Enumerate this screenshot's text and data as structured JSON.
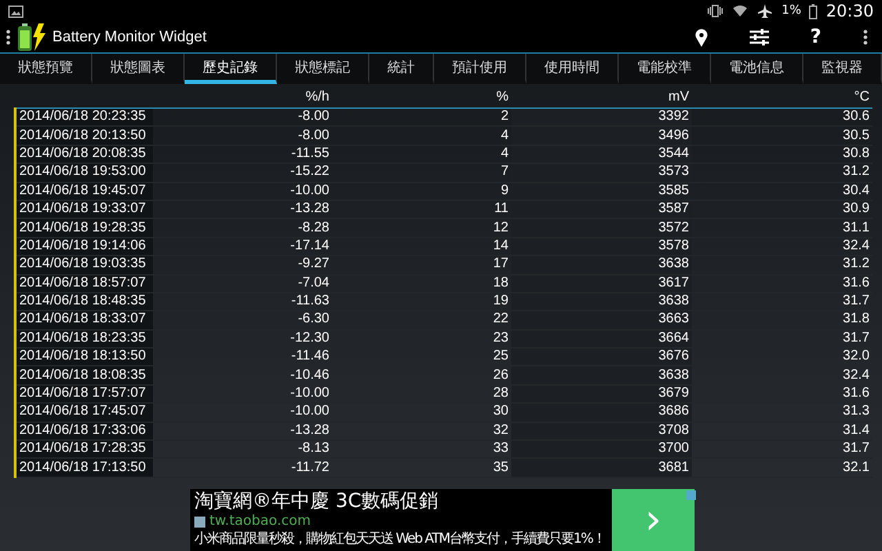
{
  "status_bar": {
    "battery": "1%",
    "time": "20:30"
  },
  "app_bar": {
    "title": "Battery Monitor Widget",
    "help": "?"
  },
  "tabs": [
    {
      "label": "狀態預覽",
      "selected": false
    },
    {
      "label": "狀態圖表",
      "selected": false
    },
    {
      "label": "歷史記錄",
      "selected": true
    },
    {
      "label": "狀態標記",
      "selected": false
    },
    {
      "label": "統計",
      "selected": false
    },
    {
      "label": "預計使用",
      "selected": false
    },
    {
      "label": "使用時間",
      "selected": false
    },
    {
      "label": "電能校準",
      "selected": false
    },
    {
      "label": "電池信息",
      "selected": false
    },
    {
      "label": "監視器",
      "selected": false
    }
  ],
  "table": {
    "columns": [
      "",
      "%/h",
      "%",
      "mV",
      "°C"
    ],
    "rows": [
      [
        "2014/06/18 20:23:35",
        "-8.00",
        "2",
        "3392",
        "30.6"
      ],
      [
        "2014/06/18 20:13:50",
        "-8.00",
        "4",
        "3496",
        "30.5"
      ],
      [
        "2014/06/18 20:08:35",
        "-11.55",
        "4",
        "3544",
        "30.8"
      ],
      [
        "2014/06/18 19:53:00",
        "-15.22",
        "7",
        "3573",
        "31.2"
      ],
      [
        "2014/06/18 19:45:07",
        "-10.00",
        "9",
        "3585",
        "30.4"
      ],
      [
        "2014/06/18 19:33:07",
        "-13.28",
        "11",
        "3587",
        "30.9"
      ],
      [
        "2014/06/18 19:28:35",
        "-8.28",
        "12",
        "3572",
        "31.1"
      ],
      [
        "2014/06/18 19:14:06",
        "-17.14",
        "14",
        "3578",
        "32.4"
      ],
      [
        "2014/06/18 19:03:35",
        "-9.27",
        "17",
        "3638",
        "31.2"
      ],
      [
        "2014/06/18 18:57:07",
        "-7.04",
        "18",
        "3617",
        "31.6"
      ],
      [
        "2014/06/18 18:48:35",
        "-11.63",
        "19",
        "3638",
        "31.7"
      ],
      [
        "2014/06/18 18:33:07",
        "-6.30",
        "22",
        "3663",
        "31.8"
      ],
      [
        "2014/06/18 18:23:35",
        "-12.30",
        "23",
        "3664",
        "31.7"
      ],
      [
        "2014/06/18 18:13:50",
        "-11.46",
        "25",
        "3676",
        "32.0"
      ],
      [
        "2014/06/18 18:08:35",
        "-10.46",
        "26",
        "3638",
        "32.4"
      ],
      [
        "2014/06/18 17:57:07",
        "-10.00",
        "28",
        "3679",
        "31.6"
      ],
      [
        "2014/06/18 17:45:07",
        "-10.00",
        "30",
        "3686",
        "31.3"
      ],
      [
        "2014/06/18 17:33:06",
        "-13.28",
        "32",
        "3708",
        "31.4"
      ],
      [
        "2014/06/18 17:28:35",
        "-8.13",
        "33",
        "3700",
        "31.7"
      ],
      [
        "2014/06/18 17:13:50",
        "-11.72",
        "35",
        "3681",
        "32.1"
      ]
    ]
  },
  "ad": {
    "headline": "淘寶網®年中慶 3C數碼促銷",
    "url": "tw.taobao.com",
    "text": "小米商品限量秒殺，購物紅包天天送 Web ATM台幣支付，手續費只要1%！",
    "button": "›"
  }
}
